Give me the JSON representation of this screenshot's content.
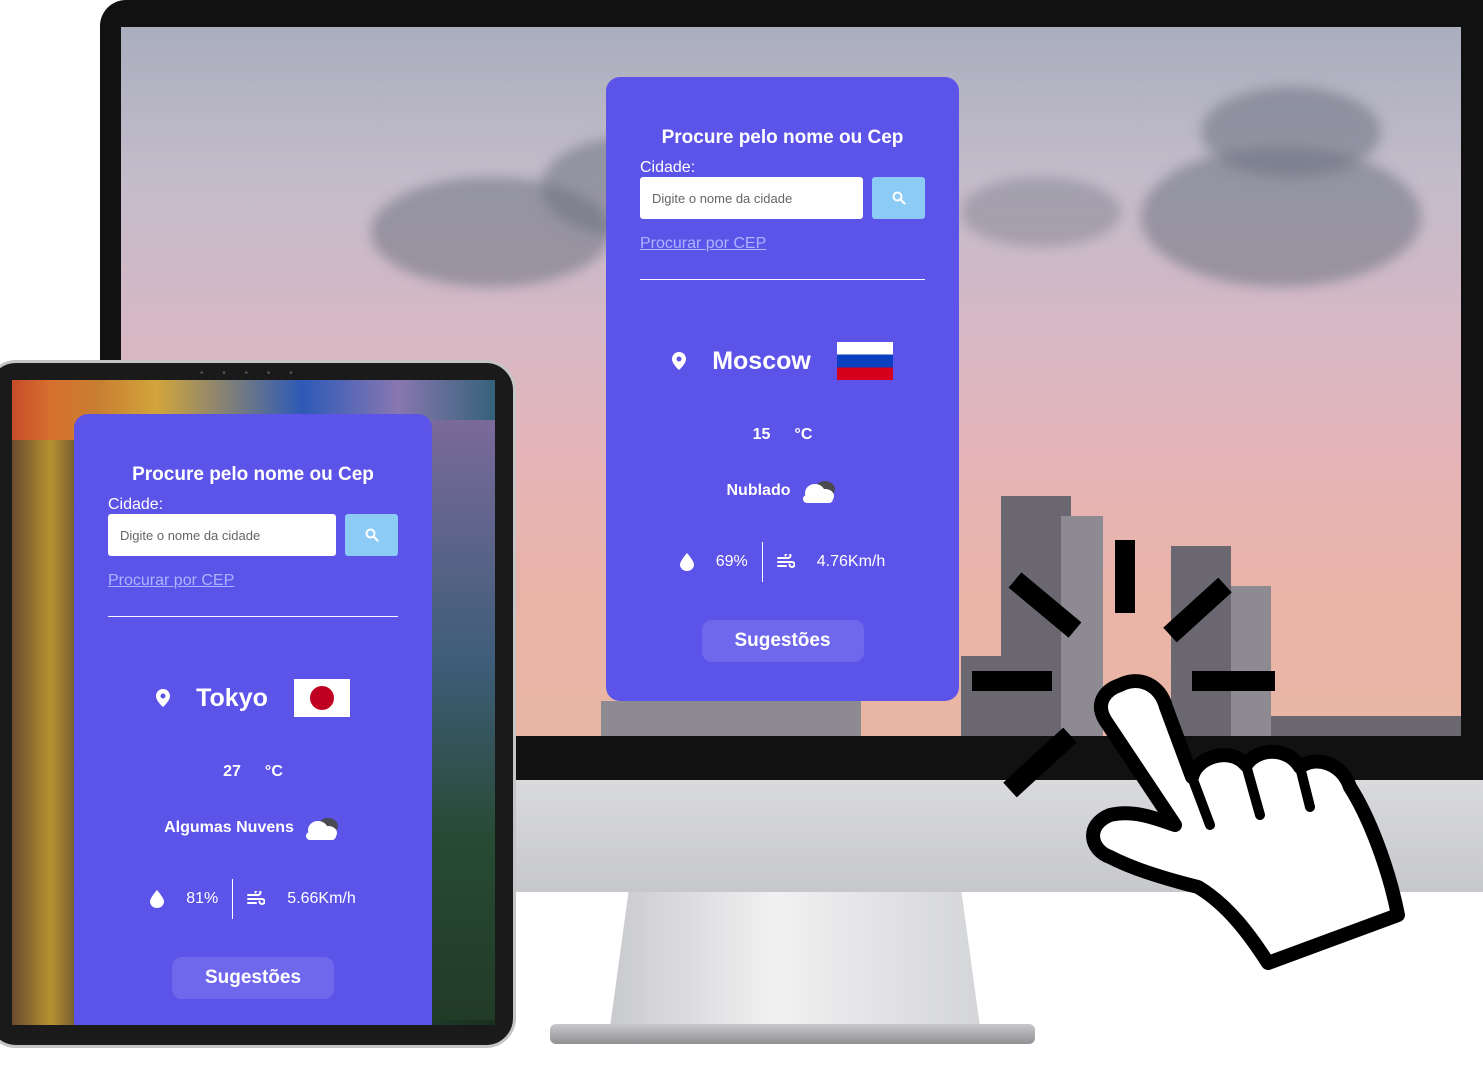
{
  "desktop": {
    "title": "Procure pelo nome ou Cep",
    "city_label": "Cidade:",
    "input_placeholder": "Digite o nome da cidade",
    "cep_link": "Procurar por CEP",
    "city": "Moscow",
    "flag": "russia-flag",
    "temperature": "15",
    "unit": "°C",
    "description": "Nublado",
    "humidity": "69%",
    "wind": "4.76Km/h",
    "suggest_button": "Sugestões"
  },
  "tablet": {
    "title": "Procure pelo nome ou Cep",
    "city_label": "Cidade:",
    "input_placeholder": "Digite o nome da cidade",
    "cep_link": "Procurar por CEP",
    "city": "Tokyo",
    "flag": "japan-flag",
    "temperature": "27",
    "unit": "°C",
    "description": "Algumas Nuvens",
    "humidity": "81%",
    "wind": "5.66Km/h",
    "suggest_button": "Sugestões"
  },
  "colors": {
    "card": "#5c53e8",
    "search_button": "#8ccbf5",
    "link": "#a9b6ff",
    "suggest_button": "#6f68ec"
  },
  "icons": [
    "search-icon",
    "location-pin-icon",
    "cloud-icon",
    "humidity-drop-icon",
    "wind-icon",
    "pointing-hand-cursor-icon"
  ]
}
